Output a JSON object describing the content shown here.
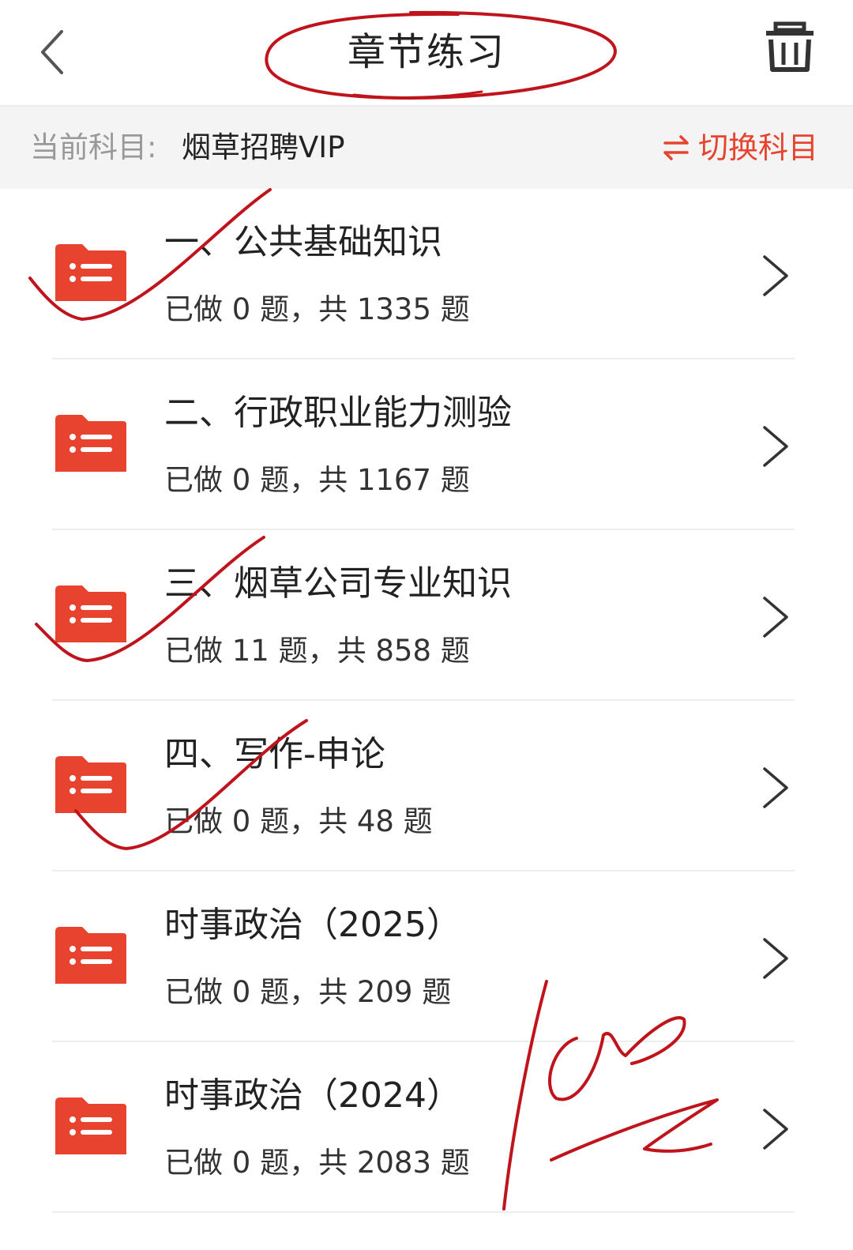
{
  "header": {
    "title": "章节练习",
    "back_icon": "chevron-left-icon",
    "trash_icon": "trash-icon"
  },
  "subject": {
    "label": "当前科目:",
    "value": "烟草招聘VIP",
    "switch_label": "切换科目",
    "switch_icon": "swap-arrows-icon"
  },
  "chapters": [
    {
      "title": "一、公共基础知识",
      "progress": "已做 0 题，共 1335 题",
      "done": 0,
      "total": 1335
    },
    {
      "title": "二、行政职业能力测验",
      "progress": "已做 0 题，共 1167 题",
      "done": 0,
      "total": 1167
    },
    {
      "title": "三、烟草公司专业知识",
      "progress": "已做 11 题，共 858 题",
      "done": 11,
      "total": 858
    },
    {
      "title": "四、写作-申论",
      "progress": "已做 0 题，共 48 题",
      "done": 0,
      "total": 48
    },
    {
      "title": "时事政治（2025）",
      "progress": "已做 0 题，共 209 题",
      "done": 0,
      "total": 209
    },
    {
      "title": "时事政治（2024）",
      "progress": "已做 0 题，共 2083 题",
      "done": 0,
      "total": 2083
    }
  ],
  "colors": {
    "accent": "#e8432f",
    "folder": "#e8432f",
    "annotation_ink": "#c0141c",
    "subject_bar_bg": "#f4f4f4"
  }
}
